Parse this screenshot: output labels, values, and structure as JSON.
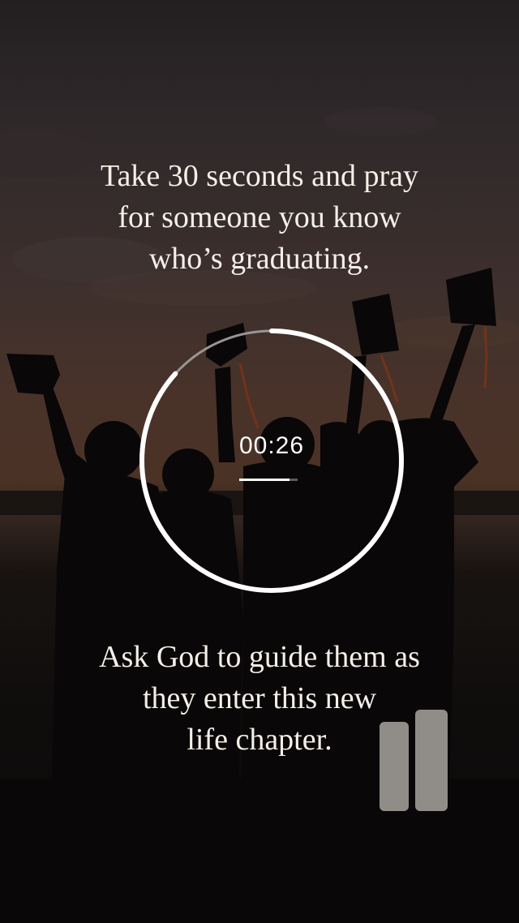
{
  "prayer": {
    "prompt_lines": [
      "Take 30 seconds and pray",
      "for someone you know",
      "who’s graduating."
    ],
    "guidance_lines": [
      "Ask God to guide them as",
      "they enter this new",
      "life chapter."
    ]
  },
  "timer": {
    "display": "00:26",
    "total_seconds": 30,
    "remaining_seconds": 26,
    "ring_color": "#ffffff",
    "track_color": "#9a9492"
  },
  "background": {
    "subject": "graduates-silhouette-icon",
    "sky_top": "#2b2729",
    "sky_horizon": "#5b3d2e",
    "ground": "#0c0b0b"
  }
}
